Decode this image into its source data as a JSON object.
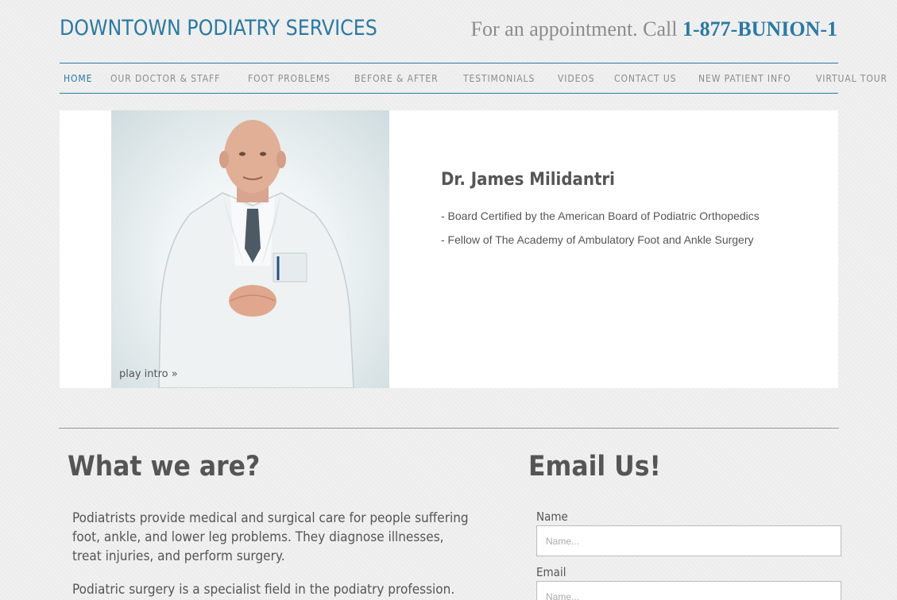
{
  "header": {
    "site_title": "DOWNTOWN PODIATRY SERVICES",
    "appointment_text": "For an appointment. Call ",
    "phone": "1-877-BUNION-1"
  },
  "nav": {
    "items": [
      {
        "label": "HOME",
        "active": true
      },
      {
        "label": "OUR DOCTOR & STAFF"
      },
      {
        "label": "FOOT PROBLEMS"
      },
      {
        "label": "BEFORE & AFTER"
      },
      {
        "label": "TESTIMONIALS"
      },
      {
        "label": "VIDEOS"
      },
      {
        "label": "CONTACT US"
      },
      {
        "label": "NEW PATIENT INFO"
      },
      {
        "label": "VIRTUAL TOUR"
      }
    ]
  },
  "hero": {
    "play_intro": "play intro »",
    "doctor_name": "Dr. James Milidantri",
    "credentials": [
      "- Board Certified by the American Board of Podiatric Orthopedics",
      "- Fellow of The Academy of Ambulatory Foot and Ankle Surgery"
    ]
  },
  "about": {
    "heading": "What we are?",
    "paragraphs": [
      "Podiatrists provide medical and surgical care for people suffering foot, ankle, and lower leg problems. They diagnose illnesses, treat injuries, and perform surgery.",
      "Podiatric surgery is a specialist field in the podiatry profession. Podiatric"
    ]
  },
  "email_form": {
    "heading": "Email Us!",
    "name_label": "Name",
    "name_placeholder": "Name...",
    "email_label": "Email",
    "email_placeholder": "Name..."
  },
  "colors": {
    "accent": "#2b79a3",
    "text": "#555555",
    "muted": "#8c8c8c"
  }
}
